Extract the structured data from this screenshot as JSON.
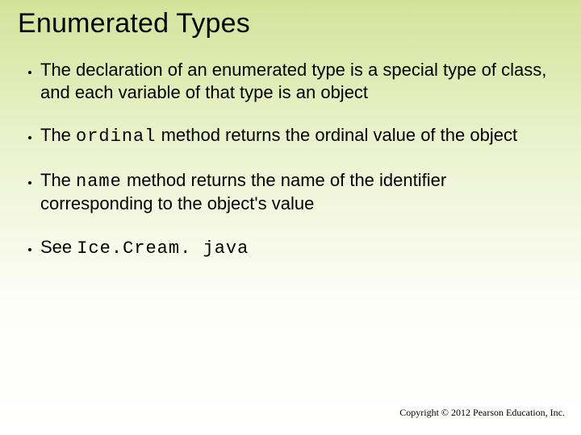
{
  "title": "Enumerated Types",
  "bullets": {
    "b1": "The declaration of an enumerated type is a special type of class, and each variable of that type is an object",
    "b2_pre": "The ",
    "b2_code": "ordinal",
    "b2_post": " method returns the ordinal value of the object",
    "b3_pre": "The ",
    "b3_code": "name",
    "b3_post": " method returns the name of the identifier corresponding to the object's value",
    "b4_pre": "See ",
    "b4_code": "Ice.Cream. java"
  },
  "footer": "Copyright © 2012 Pearson Education, Inc."
}
